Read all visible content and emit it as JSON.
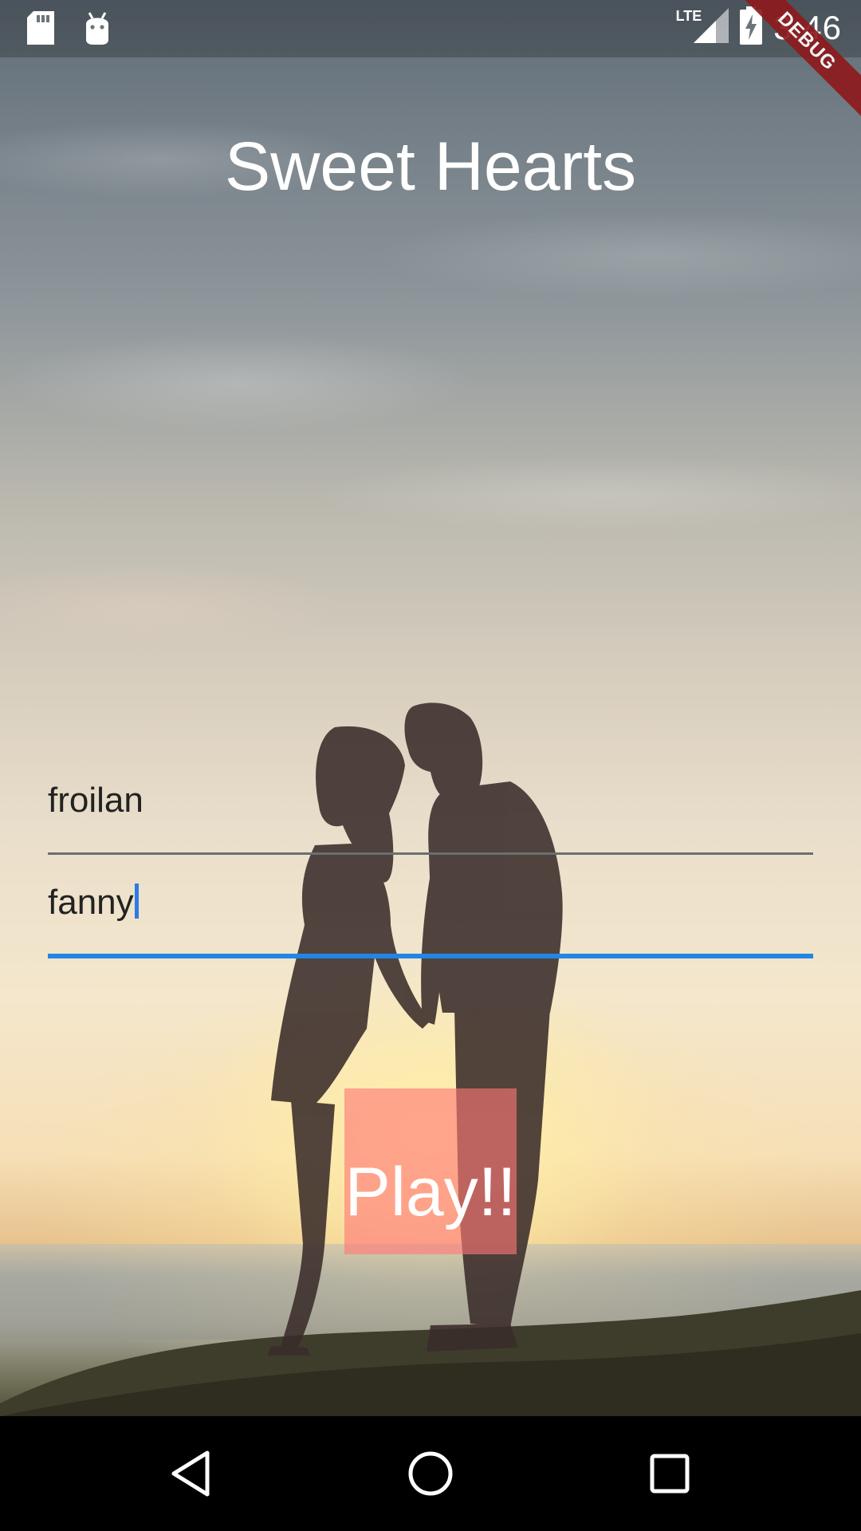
{
  "status_bar": {
    "time": "3:46",
    "network": "LTE",
    "icons": [
      "sd-card-icon",
      "android-icon",
      "signal-icon",
      "battery-charging-icon"
    ]
  },
  "debug_banner": {
    "label": "DEBUG"
  },
  "app": {
    "title": "Sweet Hearts"
  },
  "form": {
    "name1": {
      "value": "froilan"
    },
    "name2": {
      "value": "fanny",
      "focused": true
    },
    "play_label": "Play!!"
  },
  "nav_bar": {
    "icons": [
      "back-icon",
      "home-icon",
      "recents-icon"
    ]
  },
  "colors": {
    "focus_underline": "#2186e6",
    "button_fill": "#ff7878",
    "debug_banner": "#8d1b1e"
  }
}
